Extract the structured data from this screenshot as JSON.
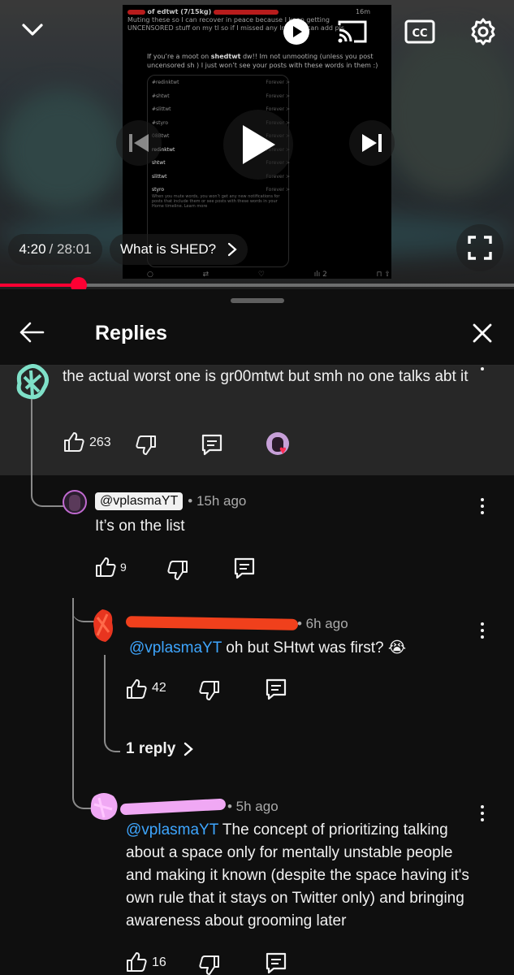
{
  "player": {
    "tweet": {
      "header_user_suffix": "of edtwt (7/15kg)",
      "header_time": "16m",
      "header_line1": "Muting these so I can recover in peace because I keep getting",
      "header_line2": "UNCENSORED stuff on my tl so if I missed any lmk so I can add pls",
      "body_line1_a": "If you’re a moot on ",
      "body_line1_b": "shedtwt",
      "body_line1_c": " dw!! Im not unmooting (unless you post",
      "body_line2": "uncensored sh  ) I just won’t see your posts with these words in them :)",
      "muted_words": [
        {
          "word": "#redinktwt",
          "duration": "Forever"
        },
        {
          "word": "#shtwt",
          "duration": "Forever"
        },
        {
          "word": "#slittwt",
          "duration": "Forever"
        },
        {
          "word": "#styro",
          "duration": "Forever"
        },
        {
          "word": "08Btwt",
          "duration": "Forever"
        },
        {
          "word": "redinktwt",
          "duration": "Forever"
        },
        {
          "word": "shtwt",
          "duration": "Forever"
        },
        {
          "word": "slittwt",
          "duration": "Forever"
        },
        {
          "word": "styro",
          "duration": "Forever"
        }
      ],
      "note": "When you mute words, you won’t get any new notifications for posts that include them or see posts with these words in your Home timeline. Learn more",
      "views": "2"
    },
    "current_time": "4:20",
    "duration": "/ 28:01",
    "chapter": "What is SHED?",
    "progress_fraction": 0.153
  },
  "sheet": {
    "title": "Replies"
  },
  "comments": [
    {
      "text": "the actual worst one is gr00mtwt but smh no one talks abt it",
      "likes": "263"
    },
    {
      "handle": "@vplasmaYT",
      "age": "• 15h ago",
      "text": "It’s on the list",
      "likes": "9"
    },
    {
      "age": "• 6h ago",
      "mention": "@vplasmaYT",
      "text": " oh but SHtwt was first? 😭",
      "likes": "42",
      "replies_link": "1 reply"
    },
    {
      "age": "• 5h ago",
      "mention": "@vplasmaYT",
      "text_line1": " The concept of prioritizing talking",
      "text_line2": "about a space only for mentally unstable people",
      "text_line3": "and making it known (despite the space having it's",
      "text_line4": "own rule that it stays on Twitter only) and bringing",
      "text_line5": "awareness about grooming later",
      "likes": "16"
    }
  ],
  "colors": {
    "accent_red": "#ff0033",
    "mention_blue": "#3ea6ff",
    "background": "#0f0f0f",
    "highlight": "#272727"
  },
  "icons": [
    "chevron-down-icon",
    "play-icon",
    "cast-icon",
    "captions-icon",
    "settings-icon",
    "previous-icon",
    "next-icon",
    "fullscreen-icon",
    "back-arrow-icon",
    "close-icon",
    "thumbs-up-icon",
    "thumbs-down-icon",
    "reply-icon",
    "kebab-menu-icon"
  ]
}
